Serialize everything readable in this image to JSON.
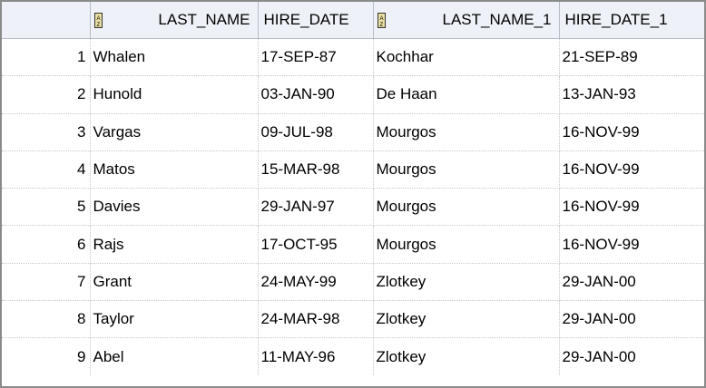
{
  "columns": [
    {
      "label": "",
      "sort_icon": false
    },
    {
      "label": "LAST_NAME",
      "sort_icon": true,
      "icon": "sort-az-icon"
    },
    {
      "label": "HIRE_DATE",
      "sort_icon": false
    },
    {
      "label": "LAST_NAME_1",
      "sort_icon": true,
      "icon": "sort-az-icon"
    },
    {
      "label": "HIRE_DATE_1",
      "sort_icon": false
    }
  ],
  "rows": [
    {
      "num": "1",
      "last_name": "Whalen",
      "hire_date": "17-SEP-87",
      "last_name_1": "Kochhar",
      "hire_date_1": "21-SEP-89"
    },
    {
      "num": "2",
      "last_name": "Hunold",
      "hire_date": "03-JAN-90",
      "last_name_1": "De Haan",
      "hire_date_1": "13-JAN-93"
    },
    {
      "num": "3",
      "last_name": "Vargas",
      "hire_date": "09-JUL-98",
      "last_name_1": "Mourgos",
      "hire_date_1": "16-NOV-99"
    },
    {
      "num": "4",
      "last_name": "Matos",
      "hire_date": "15-MAR-98",
      "last_name_1": "Mourgos",
      "hire_date_1": "16-NOV-99"
    },
    {
      "num": "5",
      "last_name": "Davies",
      "hire_date": "29-JAN-97",
      "last_name_1": "Mourgos",
      "hire_date_1": "16-NOV-99"
    },
    {
      "num": "6",
      "last_name": "Rajs",
      "hire_date": "17-OCT-95",
      "last_name_1": "Mourgos",
      "hire_date_1": "16-NOV-99"
    },
    {
      "num": "7",
      "last_name": "Grant",
      "hire_date": "24-MAY-99",
      "last_name_1": "Zlotkey",
      "hire_date_1": "29-JAN-00"
    },
    {
      "num": "8",
      "last_name": "Taylor",
      "hire_date": "24-MAR-98",
      "last_name_1": "Zlotkey",
      "hire_date_1": "29-JAN-00"
    },
    {
      "num": "9",
      "last_name": "Abel",
      "hire_date": "11-MAY-96",
      "last_name_1": "Zlotkey",
      "hire_date_1": "29-JAN-00"
    }
  ]
}
